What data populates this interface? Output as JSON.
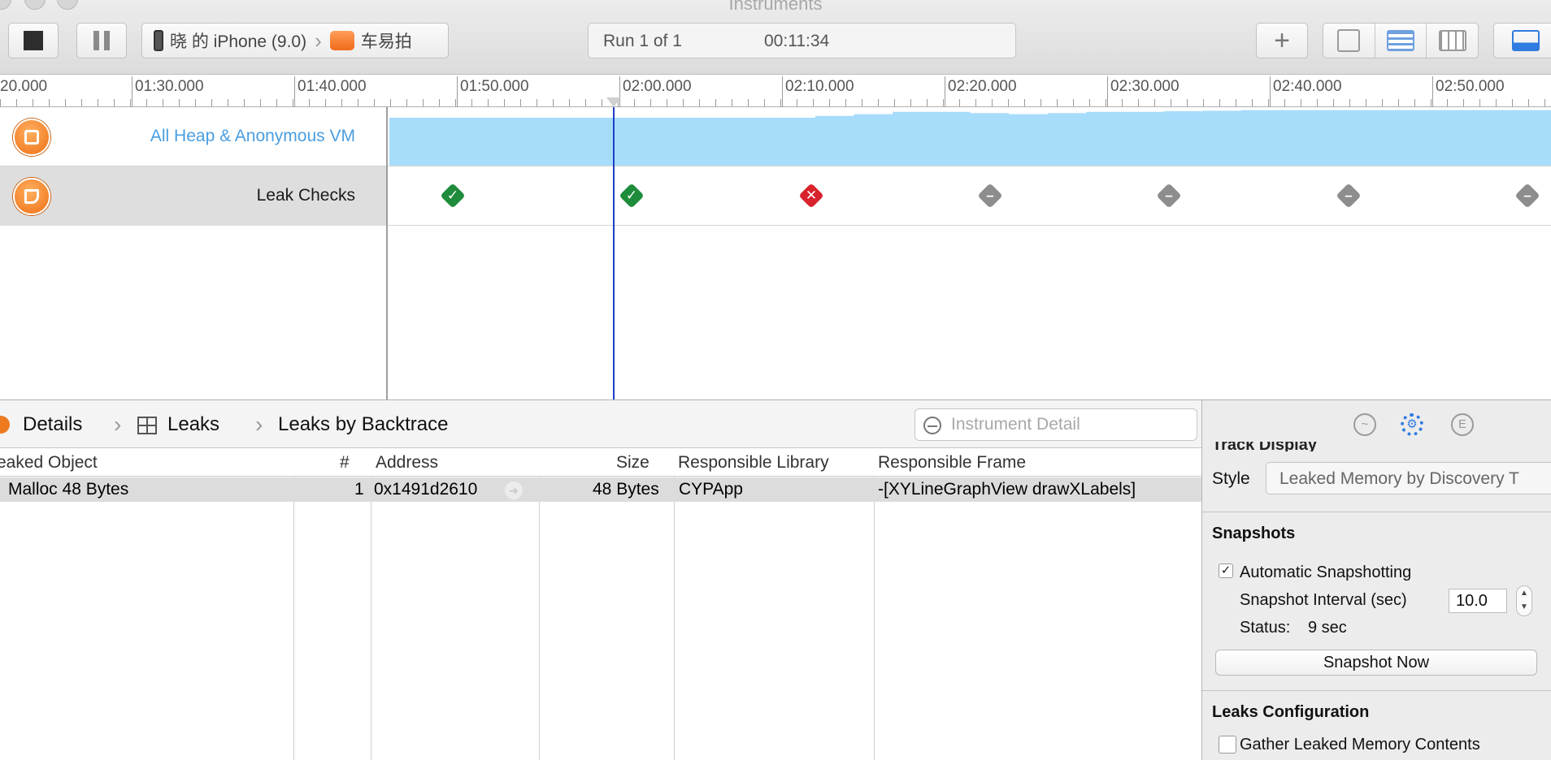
{
  "window": {
    "title": "Instruments"
  },
  "toolbar": {
    "device": "晓 的 iPhone (9.0)",
    "app": "车易拍",
    "run_label": "Run 1 of 1",
    "elapsed": "00:11:34",
    "add_symbol": "+"
  },
  "ruler": {
    "labels": [
      "20.000",
      "01:30.000",
      "01:40.000",
      "01:50.000",
      "02:00.000",
      "02:10.000",
      "02:20.000",
      "02:30.000",
      "02:40.000",
      "02:50.000"
    ]
  },
  "tracks": [
    {
      "name": "All Heap & Anonymous VM",
      "icon": "box-icon",
      "color": "#4a9ee0"
    },
    {
      "name": "Leak Checks",
      "icon": "faucet-icon",
      "selected": true
    }
  ],
  "heap_levels": [
    0.0,
    0.0,
    0.0,
    0.0,
    0.0,
    0.0,
    0.82,
    0.82,
    0.8,
    0.78,
    0.8,
    0.85,
    0.88,
    0.92,
    0.92,
    0.9,
    0.88,
    0.9,
    0.92,
    0.92,
    0.93,
    0.94,
    0.95,
    0.95,
    0.95,
    0.95,
    0.95,
    0.95,
    0.95,
    0.95
  ],
  "leak_checks": [
    {
      "status": "ok",
      "symbol": "✓"
    },
    {
      "status": "ok",
      "symbol": "✓"
    },
    {
      "status": "leak",
      "symbol": "✕"
    },
    {
      "status": "none",
      "symbol": "–"
    },
    {
      "status": "none",
      "symbol": "–"
    },
    {
      "status": "none",
      "symbol": "–"
    },
    {
      "status": "none",
      "symbol": "–"
    }
  ],
  "detail": {
    "breadcrumbs": [
      "Details",
      "Leaks",
      "Leaks by Backtrace"
    ],
    "search_placeholder": "Instrument Detail"
  },
  "table": {
    "columns": [
      "eaked Object",
      "#",
      "Address",
      "Size",
      "Responsible Library",
      "Responsible Frame"
    ],
    "rows": [
      {
        "object": "Malloc 48 Bytes",
        "count": "1",
        "address": "0x1491d2610",
        "size": "48 Bytes",
        "library": "CYPApp",
        "frame": "-[XYLineGraphView drawXLabels]"
      }
    ]
  },
  "inspector": {
    "tabs": [
      "~",
      "⚙",
      "E"
    ],
    "clipped_section": "Track Display",
    "style_label": "Style",
    "style_value": "Leaked Memory by Discovery T",
    "snapshots_title": "Snapshots",
    "auto_snapshot_label": "Automatic Snapshotting",
    "auto_snapshot_checked": "✓",
    "interval_label": "Snapshot Interval (sec)",
    "interval_value": "10.0",
    "status_label": "Status:",
    "status_value": "9 sec",
    "snapshot_button": "Snapshot Now",
    "leaks_config_title": "Leaks Configuration",
    "gather_label": "Gather Leaked Memory Contents"
  },
  "colors": {
    "heap_fill": "#a8dcfb",
    "playhead": "#1f3fc8",
    "leak_ok": "#1e8c3a",
    "leak_bad": "#d8222c",
    "leak_none": "#8d8d8d"
  }
}
